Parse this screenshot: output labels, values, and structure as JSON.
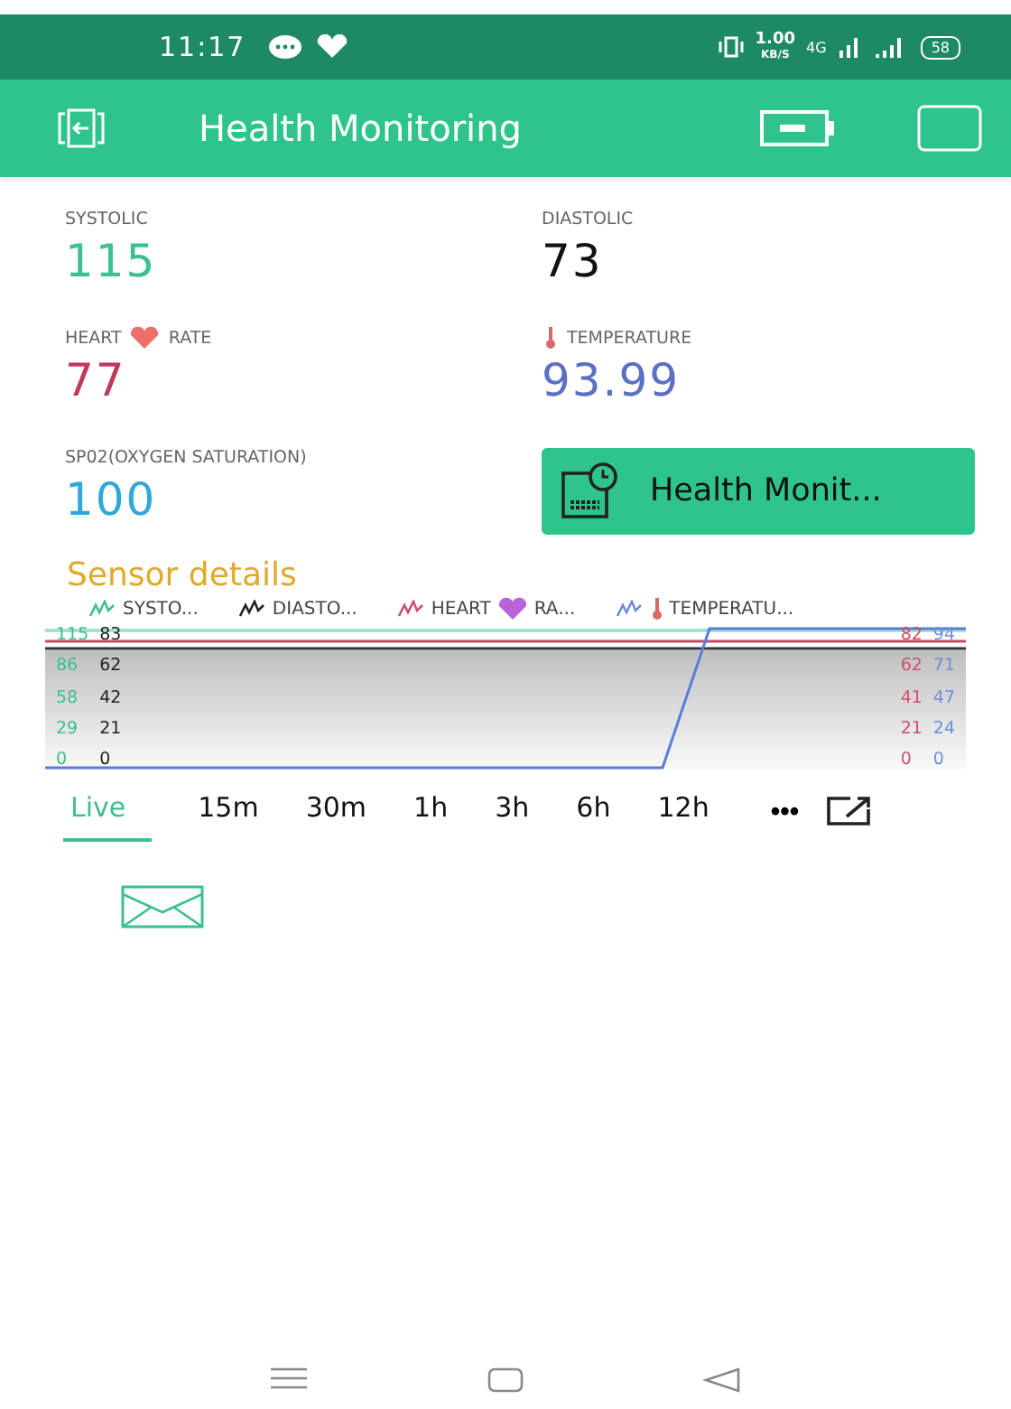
{
  "status_bar": {
    "time": "11:17",
    "speed": "1.00",
    "speed_unit": "KB/S",
    "network": "4G",
    "battery": "58"
  },
  "header": {
    "title": "Health Monitoring"
  },
  "widgets": [
    {
      "kind": "plain",
      "label": "SYSTOLIC",
      "value": "115",
      "color": "#3dbf8f"
    },
    {
      "kind": "plain",
      "label": "DIASTOLIC",
      "value": "73",
      "color": "#111111"
    },
    {
      "kind": "heart",
      "label": "HEART",
      "label_after": "RATE",
      "value": "77",
      "color": "#c0395a"
    },
    {
      "kind": "thermometer",
      "label": "TEMPERATURE",
      "value": "93.99",
      "color": "#5b6fc4"
    },
    {
      "kind": "plain",
      "label": "SP02(OXYGEN SATURATION)",
      "value": "100",
      "color": "#2fa8d8"
    }
  ],
  "report_button": {
    "label": "Health Monit..."
  },
  "chart": {
    "title": "Sensor details",
    "legend": [
      {
        "label": "SYSTO...",
        "color": "#3dbf8f"
      },
      {
        "label": "DIASTO...",
        "color": "#222222"
      },
      {
        "label": "HEART",
        "label_after": "RA...",
        "color": "#d0506a",
        "kind": "heart"
      },
      {
        "label": "TEMPERATU...",
        "color": "#6f8ed8",
        "kind": "thermometer"
      }
    ],
    "left_axes": [
      {
        "color": "#3dbf8f",
        "ticks": [
          "115",
          "86",
          "58",
          "29",
          "0"
        ]
      },
      {
        "color": "#222222",
        "ticks": [
          "83",
          "62",
          "42",
          "21",
          "0"
        ]
      }
    ],
    "right_axes": [
      {
        "color": "#d0506a",
        "ticks": [
          "82",
          "62",
          "41",
          "21",
          "0"
        ]
      },
      {
        "color": "#6f8ed8",
        "ticks": [
          "94",
          "71",
          "47",
          "24",
          "0"
        ]
      }
    ]
  },
  "periods": [
    {
      "label": "Live",
      "selected": true
    },
    {
      "label": "15m",
      "selected": false
    },
    {
      "label": "30m",
      "selected": false
    },
    {
      "label": "1h",
      "selected": false
    },
    {
      "label": "3h",
      "selected": false
    },
    {
      "label": "6h",
      "selected": false
    },
    {
      "label": "12h",
      "selected": false
    }
  ],
  "more": "•••"
}
